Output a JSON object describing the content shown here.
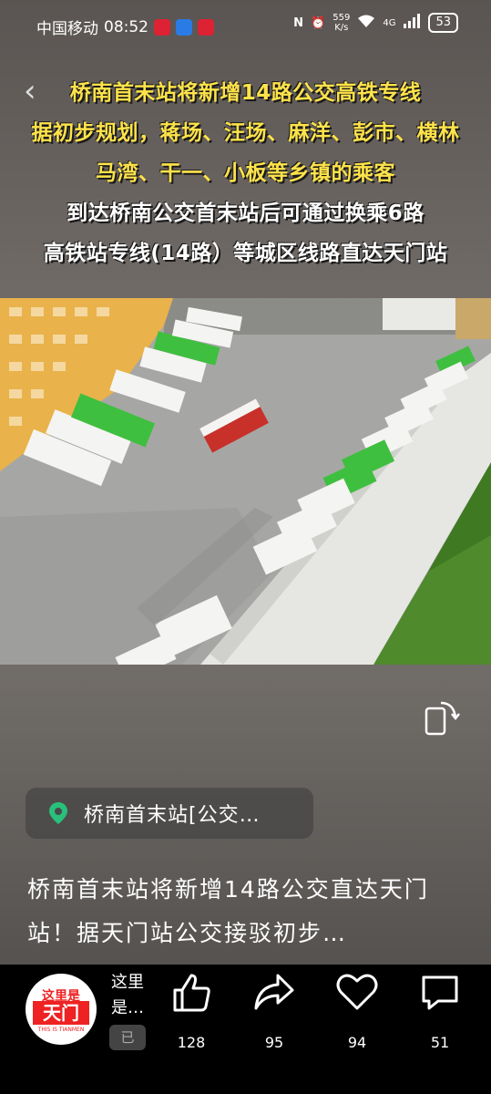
{
  "status": {
    "carrier": "中国移动",
    "time": "08:52",
    "net_speed_value": "559",
    "net_speed_unit": "K/s",
    "network": "4G",
    "battery": "53"
  },
  "overlay": {
    "caption_lines": [
      "桥南首末站将新增14路公交高铁专线",
      "据初步规划，蒋场、汪场、麻洋、彭市、横林",
      "马湾、干一、小板等乡镇的乘客",
      "到达桥南公交首末站后可通过换乘6路",
      "高铁站专线(14路）等城区线路直达天门站"
    ]
  },
  "location": {
    "text": "桥南首末站[公交…"
  },
  "description": {
    "line1": "桥南首末站将新增14路公交直达天门",
    "line2": "站！据天门站公交接驳初步…"
  },
  "author": {
    "name_line1": "这里",
    "name_line2": "是…",
    "follow_label": "已",
    "avatar_text_top": "这里是",
    "avatar_text_mid": "天门",
    "avatar_text_bottom": "THIS IS TIANMEN"
  },
  "actions": {
    "like_count": "128",
    "share_count": "95",
    "favorite_count": "94",
    "comment_count": "51"
  },
  "colors": {
    "caption_yellow": "#ffe34a",
    "bus_green": "#3fbf3f",
    "bus_red": "#c8302a"
  }
}
